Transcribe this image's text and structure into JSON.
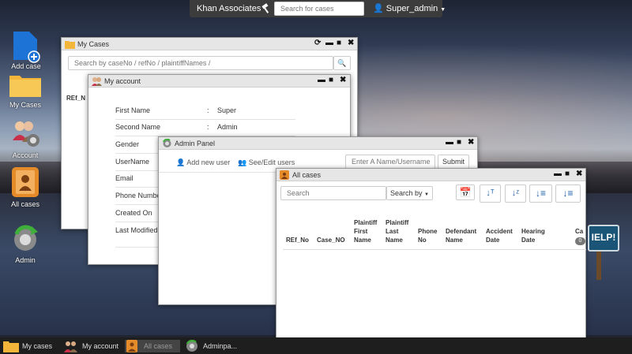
{
  "topbar": {
    "brand": "Khan Associates",
    "search_placeholder": "Search for cases",
    "user": "Super_admin"
  },
  "desktop": {
    "icons": [
      {
        "label": "Add case",
        "icon": "add-case-icon"
      },
      {
        "label": "My Cases",
        "icon": "folder-icon"
      },
      {
        "label": "Account",
        "icon": "account-icon"
      },
      {
        "label": "All cases",
        "icon": "all-cases-icon"
      },
      {
        "label": "Admin",
        "icon": "admin-icon"
      }
    ]
  },
  "my_cases_window": {
    "title": "My Cases",
    "search_placeholder": "Search by caseNo / refNo / plaintiffNames /",
    "partial_header": "REf_N"
  },
  "account_window": {
    "title": "My account",
    "fields": [
      {
        "label": "First Name",
        "value": "Super"
      },
      {
        "label": "Second Name",
        "value": "Admin"
      },
      {
        "label": "Gender",
        "value": ""
      },
      {
        "label": "UserName",
        "value": ""
      },
      {
        "label": "Email",
        "value": ""
      },
      {
        "label": "Phone Numbe",
        "value": ""
      },
      {
        "label": "Created On",
        "value": ""
      },
      {
        "label": "Last Modified",
        "value": ""
      }
    ]
  },
  "admin_panel": {
    "title": "Admin Panel",
    "add_user": "Add new user",
    "see_edit": "See/Edit users",
    "search_placeholder": "Enter A Name/Username",
    "submit": "Submit"
  },
  "all_cases": {
    "title": "All cases",
    "search_placeholder": "Search",
    "search_by": "Search by",
    "columns": [
      {
        "l1": "",
        "l2": "",
        "l3": "REf_No"
      },
      {
        "l1": "",
        "l2": "",
        "l3": "Case_NO"
      },
      {
        "l1": "Plaintiff",
        "l2": "First",
        "l3": "Name"
      },
      {
        "l1": "Plaintiff",
        "l2": "Last",
        "l3": "Name"
      },
      {
        "l1": "",
        "l2": "Phone",
        "l3": "No"
      },
      {
        "l1": "",
        "l2": "Defendant",
        "l3": "Name"
      },
      {
        "l1": "",
        "l2": "Accident",
        "l3": "Date"
      },
      {
        "l1": "",
        "l2": "Hearing",
        "l3": "Date"
      },
      {
        "l1": "",
        "l2": "Ca",
        "l3": ""
      }
    ],
    "badge": "0"
  },
  "help_sign": "IELP!",
  "taskbar": [
    {
      "label": "My cases",
      "icon": "folder-icon"
    },
    {
      "label": "My account",
      "icon": "account-icon"
    },
    {
      "label": "All cases",
      "icon": "all-cases-icon"
    },
    {
      "label": "Adminpa...",
      "icon": "admin-icon"
    }
  ]
}
